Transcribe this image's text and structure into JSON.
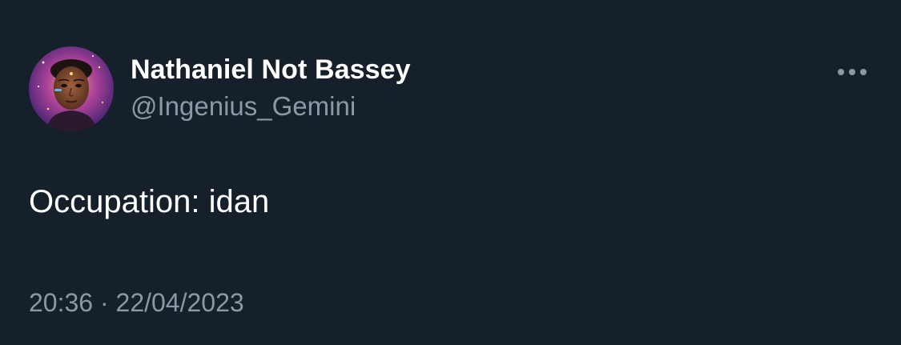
{
  "author": {
    "display_name": "Nathaniel Not Bassey",
    "handle": "@Ingenius_Gemini",
    "avatar": "profile-photo"
  },
  "menu": {
    "icon": "more-horizontal-icon"
  },
  "tweet": {
    "text": "Occupation: idan",
    "time": "20:36",
    "separator": "·",
    "date": "22/04/2023"
  },
  "colors": {
    "background": "#15202b",
    "primary_text": "#ffffff",
    "secondary_text": "#8b98a5"
  }
}
